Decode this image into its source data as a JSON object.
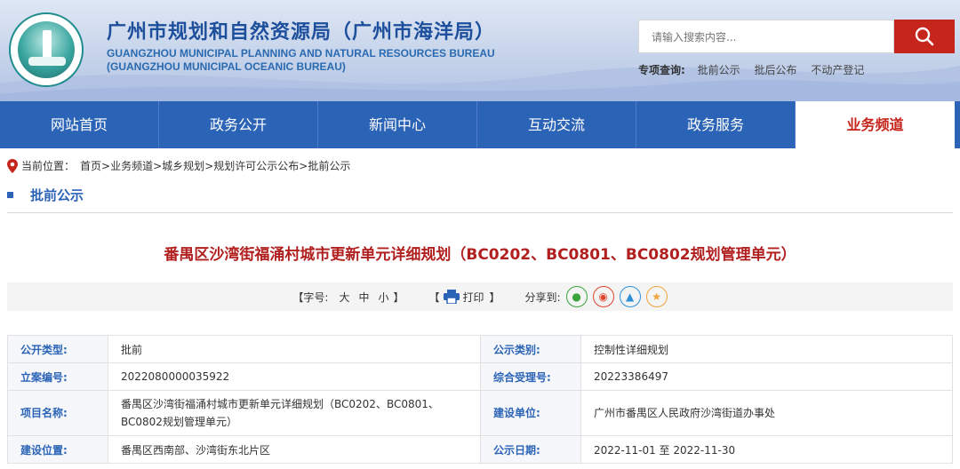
{
  "header": {
    "title_cn": "广州市规划和自然资源局（广州市海洋局）",
    "title_en_1": "GUANGZHOU MUNICIPAL PLANNING AND NATURAL RESOURCES BUREAU",
    "title_en_2": "(GUANGZHOU MUNICIPAL OCEANIC BUREAU)",
    "search_placeholder": "请输入搜索内容...",
    "special_label": "专项查询:",
    "special_links": [
      "批前公示",
      "批后公布",
      "不动产登记"
    ]
  },
  "nav": [
    {
      "label": "网站首页"
    },
    {
      "label": "政务公开"
    },
    {
      "label": "新闻中心"
    },
    {
      "label": "互动交流"
    },
    {
      "label": "政务服务"
    },
    {
      "label": "业务频道"
    }
  ],
  "breadcrumb": {
    "label": "当前位置：",
    "items": [
      "首页",
      "业务频道",
      "城乡规划",
      "规划许可公示公布",
      "批前公示"
    ],
    "sep": " > "
  },
  "section_title": "批前公示",
  "article_title": "番禺区沙湾街福涌村城市更新单元详细规划（BC0202、BC0801、BC0802规划管理单元）",
  "tools": {
    "font_label": "【字号:",
    "sizes": [
      "大",
      "中",
      "小"
    ],
    "font_close": "】",
    "print_open": "【",
    "print_label": "打印",
    "print_close": "】",
    "share_label": "分享到:"
  },
  "info": {
    "rows": [
      {
        "l1": "公开类型:",
        "v1": "批前",
        "l2": "公示类别:",
        "v2": "控制性详细规划"
      },
      {
        "l1": "立案编号:",
        "v1": "2022080000035922",
        "l2": "综合受理号:",
        "v2": "20223386497"
      },
      {
        "l1": "项目名称:",
        "v1": "番禺区沙湾街福涌村城市更新单元详细规划（BC0202、BC0801、BC0802规划管理单元）",
        "l2": "建设单位:",
        "v2": "广州市番禺区人民政府沙湾街道办事处"
      },
      {
        "l1": "建设位置:",
        "v1": "番禺区西南部、沙湾街东北片区",
        "l2": "公示日期:",
        "v2": "2022-11-01 至 2022-11-30"
      }
    ]
  },
  "colors": {
    "primary": "#2b63b6",
    "accent": "#c6251c"
  }
}
